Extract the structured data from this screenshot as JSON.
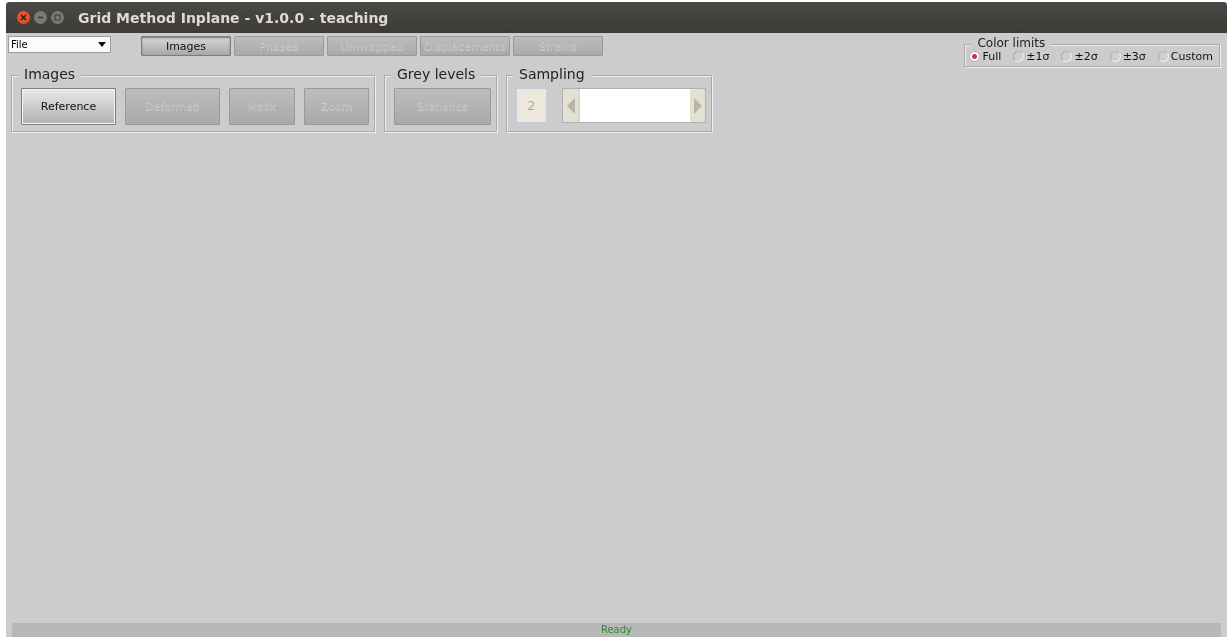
{
  "window": {
    "title": "Grid Method Inplane - v1.0.0 - teaching"
  },
  "file_menu": {
    "label": "File"
  },
  "tabs": [
    {
      "label": "Images",
      "selected": true,
      "disabled": false
    },
    {
      "label": "Phases",
      "selected": false,
      "disabled": true
    },
    {
      "label": "Unwrapped",
      "selected": false,
      "disabled": true
    },
    {
      "label": "Displacements",
      "selected": false,
      "disabled": true
    },
    {
      "label": "Strains",
      "selected": false,
      "disabled": true
    }
  ],
  "images_group": {
    "title": "Images",
    "buttons": [
      {
        "label": "Reference",
        "disabled": false
      },
      {
        "label": "Deformed",
        "disabled": true
      },
      {
        "label": "Mask",
        "disabled": true
      },
      {
        "label": "Zoom",
        "disabled": true
      }
    ]
  },
  "grey_levels_group": {
    "title": "Grey levels",
    "buttons": [
      {
        "label": "Statistics",
        "disabled": true
      }
    ]
  },
  "sampling_group": {
    "title": "Sampling",
    "value": "2",
    "level": 0
  },
  "color_limits": {
    "title": "Color limits",
    "options": [
      {
        "label": "Full",
        "selected": true
      },
      {
        "label": "±1σ",
        "selected": false
      },
      {
        "label": "±2σ",
        "selected": false
      },
      {
        "label": "±3σ",
        "selected": false
      },
      {
        "label": "Custom",
        "selected": false
      }
    ]
  },
  "status_bar": {
    "text": "Ready"
  }
}
